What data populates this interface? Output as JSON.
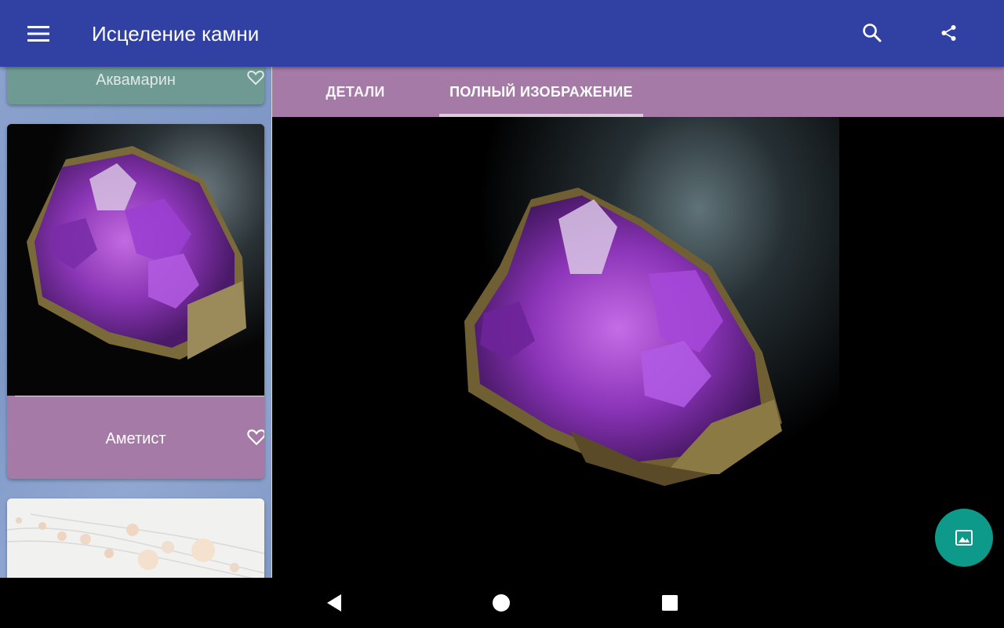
{
  "app_bar": {
    "title": "Исцеление камни",
    "menu_icon": "menu-icon",
    "search_icon": "search-icon",
    "share_icon": "share-icon",
    "background": "#3141a3"
  },
  "stone_list": {
    "items": [
      {
        "name": "Аквамарин",
        "favorite_icon": "heart-outline-icon",
        "color": "#6f9a94"
      },
      {
        "name": "Аметист",
        "favorite_icon": "heart-outline-icon",
        "color": "#a57aa6"
      },
      {
        "name": "",
        "image": "pearl-necklace-image"
      }
    ]
  },
  "tabs": [
    {
      "label": "ДЕТАЛИ",
      "selected": false
    },
    {
      "label": "ПОЛНЫЙ ИЗОБРАЖЕНИЕ",
      "selected": true
    }
  ],
  "fab": {
    "icon": "image-icon",
    "color": "#0e9a8a"
  },
  "nav_bar": {
    "back_icon": "back-icon",
    "home_icon": "home-icon",
    "recents_icon": "recents-icon"
  }
}
